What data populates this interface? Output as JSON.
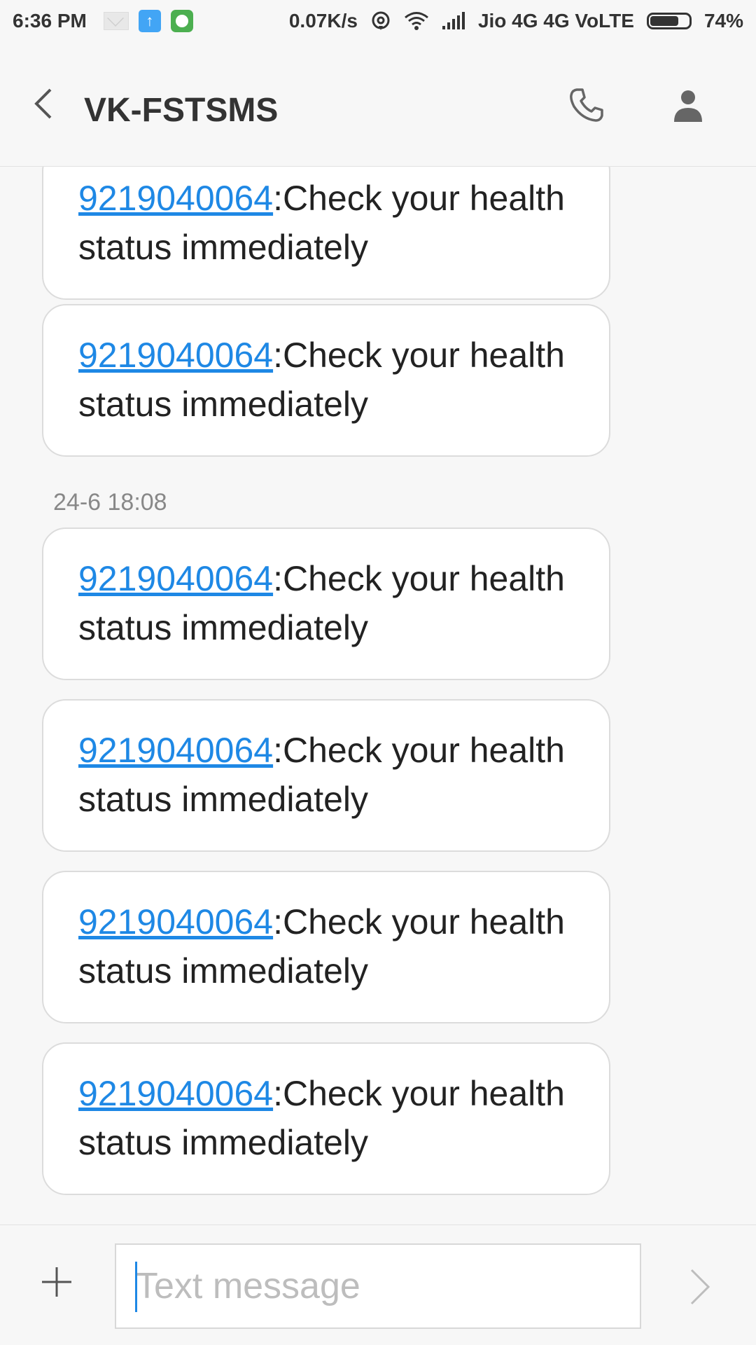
{
  "status_bar": {
    "time": "6:36 PM",
    "net_speed": "0.07K/s",
    "carrier": "Jio 4G 4G  VoLTE",
    "battery": "74%",
    "battery_level": 0.74,
    "icons": [
      "mail-icon",
      "upload-icon",
      "chat-app-icon",
      "hotspot-icon",
      "wifi-icon",
      "signal-icon",
      "battery-icon"
    ]
  },
  "header": {
    "title": "VK-FSTSMS",
    "icons": [
      "back-arrow-icon",
      "phone-icon",
      "contact-icon"
    ]
  },
  "conversation": {
    "date_separator": "24-6 18:08",
    "messages": [
      {
        "link": "9219040064",
        "text": ":Check your health status immediately"
      },
      {
        "link": "9219040064",
        "text": ":Check your health status immediately"
      },
      {
        "link": "9219040064",
        "text": ":Check your health status immediately"
      },
      {
        "link": "9219040064",
        "text": ":Check your health status immediately"
      },
      {
        "link": "9219040064",
        "text": ":Check your health status immediately"
      },
      {
        "link": "9219040064",
        "text": ":Check your health status immediately"
      }
    ]
  },
  "composer": {
    "placeholder": "Text message",
    "icons": [
      "plus-icon",
      "send-icon"
    ]
  },
  "colors": {
    "link": "#1e88e5",
    "background": "#f7f7f7",
    "bubble": "#ffffff"
  }
}
